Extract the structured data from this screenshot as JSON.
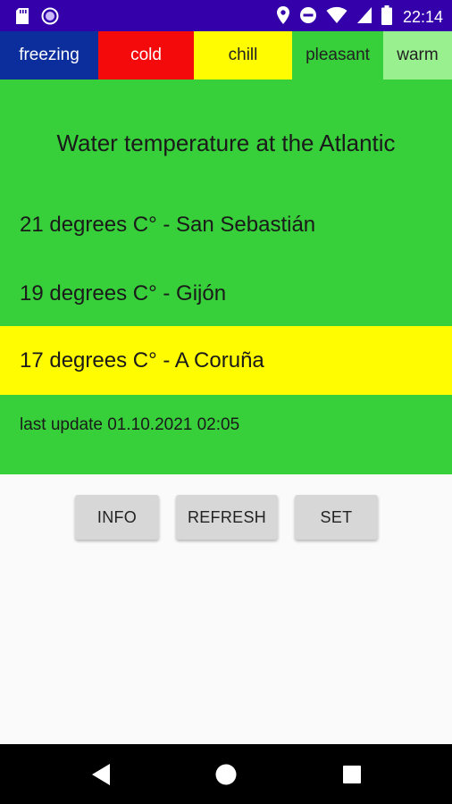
{
  "status_bar": {
    "time": "22:14",
    "icons": [
      "sd-card-icon",
      "circle-notification-icon",
      "location-icon",
      "do-not-disturb-icon",
      "wifi-icon",
      "signal-icon",
      "battery-icon"
    ]
  },
  "legend": {
    "freezing": "freezing",
    "cold": "cold",
    "chill": "chill",
    "pleasant": "pleasant",
    "warm": "warm"
  },
  "colors": {
    "status_bar": "#3300aa",
    "freezing": "#0b2e9c",
    "cold": "#f40a0a",
    "chill": "#fffb00",
    "pleasant": "#37cf3a",
    "warm": "#98f08e",
    "highlight": "#fffb00"
  },
  "panel": {
    "title": "Water temperature at the Atlantic",
    "readings": [
      {
        "text": "21 degrees C° - San Sebastián"
      },
      {
        "text": "19 degrees C° - Gijón"
      },
      {
        "text": "17 degrees C° - A Coruña"
      }
    ],
    "last_update": "last update 01.10.2021 02:05"
  },
  "buttons": {
    "info": "INFO",
    "refresh": "REFRESH",
    "set": "SET"
  },
  "nav": {
    "icons": [
      "back-icon",
      "home-icon",
      "recents-icon"
    ]
  }
}
